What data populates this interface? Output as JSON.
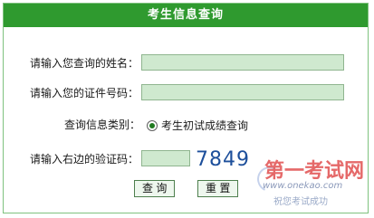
{
  "header": {
    "title": "考生信息查询"
  },
  "form": {
    "name_label": "请输入您查询的姓名：",
    "id_label": "请输入您的证件号码：",
    "query_type_label": "查询信息类别：",
    "query_type_option": "考生初试成绩查询",
    "captcha_label": "请输入右边的验证码：",
    "captcha_value": "7849",
    "name_value": "",
    "id_value": "",
    "captcha_input_value": ""
  },
  "actions": {
    "query_label": "查 询",
    "reset_label": "重 置"
  },
  "watermark": {
    "text": "第一考试网",
    "url": "www.onekao.com",
    "slogan": "祝您考试成功"
  },
  "colors": {
    "accent": "#2f9a2f",
    "input_bg": "#cfe9cf",
    "captcha_text": "#1d4f9b",
    "watermark": "#e35d5d"
  }
}
